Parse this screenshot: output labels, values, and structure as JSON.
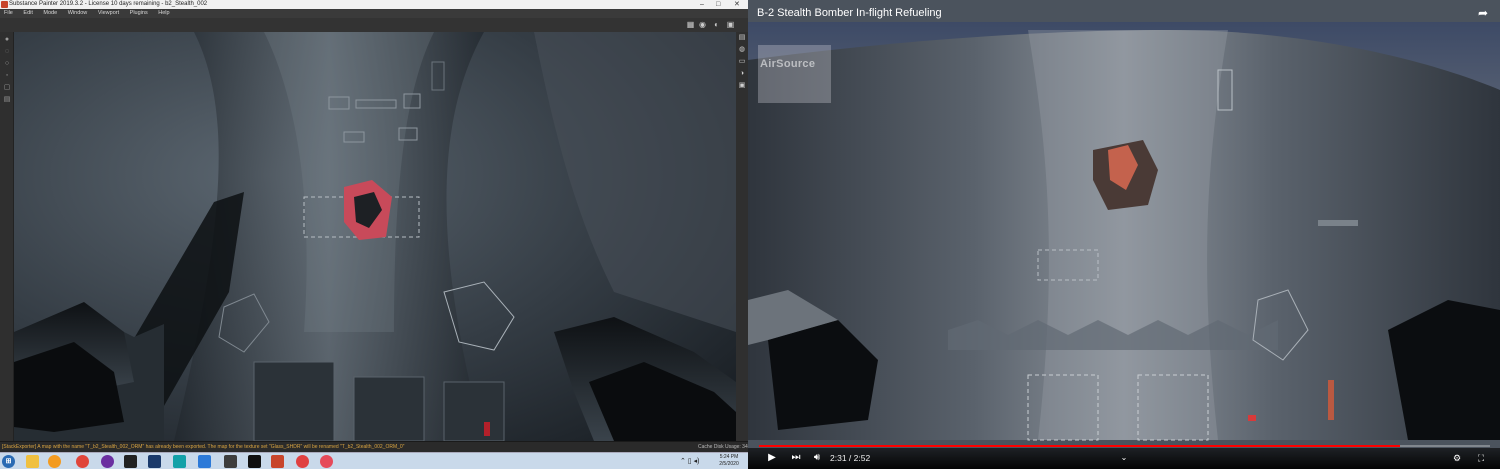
{
  "substance_painter": {
    "window_title": "Substance Painter 2019.3.2 - License 10 days remaining - b2_Stealth_002",
    "window_controls": [
      "–",
      "□",
      "✕"
    ],
    "menu": [
      "File",
      "Edit",
      "Mode",
      "Window",
      "Viewport",
      "Plugins",
      "Help"
    ],
    "log_message": "[StackExporter] A map with the name \"T_b2_Stealth_002_ORM\" has already been exported. The map for the texture set \"Glass_SHDR\" will be renamed \"T_b2_Stealth_002_ORM_0\"",
    "cache_status": "Cache Disk Usage:  34%"
  },
  "taskbar": {
    "apps": [
      "start",
      "explorer",
      "chrome",
      "obs",
      "photoshop",
      "unreal",
      "maya",
      "ue",
      "substance",
      "record"
    ],
    "clock_time": "5:24 PM",
    "clock_date": "2/5/2020"
  },
  "video": {
    "title": "B-2 Stealth Bomber In-flight Refueling",
    "watermark": "AirSource",
    "time": "2:31 / 2:52",
    "progress": 0.877
  }
}
